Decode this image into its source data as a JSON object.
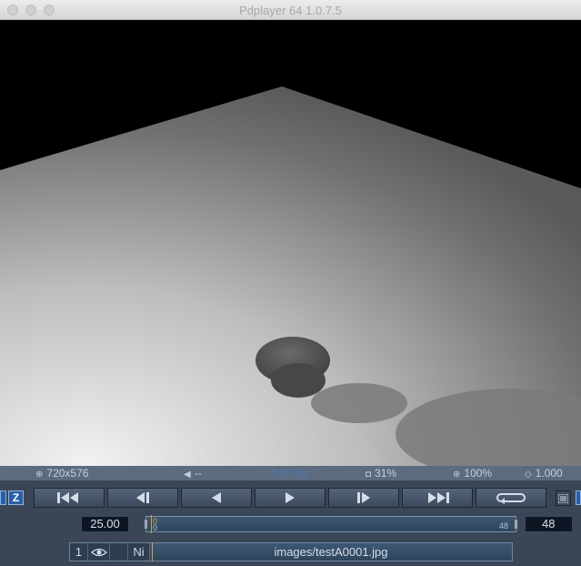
{
  "window": {
    "title": "Pdplayer 64 1.0.7.5"
  },
  "info_bar": {
    "resolution": "720x576",
    "audio": "--",
    "fps_actual": "4.00 fps",
    "cache": "31%",
    "zoom": "100%",
    "aspect": "1.000"
  },
  "transport": {
    "buttons": [
      "go-to-start",
      "step-back",
      "play-backward",
      "play-forward",
      "step-forward",
      "go-to-end",
      "loop"
    ],
    "left_edge_labels": [
      "",
      "Z"
    ]
  },
  "timeline": {
    "fps_value": "25.00",
    "start_marker_top": "0",
    "start_marker_bottom": "0",
    "end_marker": "48",
    "end_frame": "48",
    "current_frame_fraction": 0
  },
  "layer": {
    "index": "1",
    "blend": "Ni",
    "file": "images/testA0001.jpg"
  },
  "colors": {
    "panel_bg": "#3a4656",
    "accent_playhead": "#d1a93a",
    "info_bar_bg": "#5c6b7d"
  }
}
